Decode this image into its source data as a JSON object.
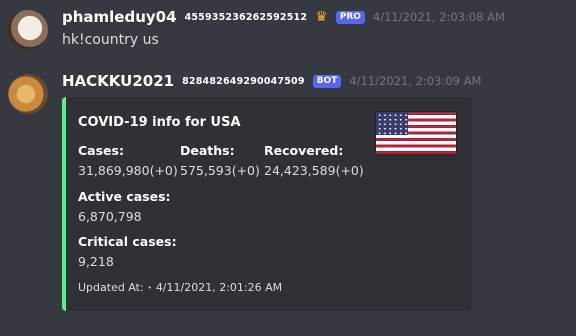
{
  "messages": [
    {
      "username": "phamleduy04",
      "user_id": "455935236262592512",
      "crown_icon": "crown-icon",
      "badge": "PRO",
      "timestamp": "4/11/2021, 2:03:08 AM",
      "text": "hk!country us"
    },
    {
      "username": "HACKKU2021",
      "user_id": "828482649290047509",
      "badge": "BOT",
      "timestamp": "4/11/2021, 2:03:09 AM"
    }
  ],
  "embed": {
    "accent_color": "#57f287",
    "title": "COVID-19 info for USA",
    "thumbnail": "us-flag",
    "fields": {
      "cases": {
        "name": "Cases:",
        "value": "31,869,980(+0)"
      },
      "deaths": {
        "name": "Deaths:",
        "value": "575,593(+0)"
      },
      "recovered": {
        "name": "Recovered:",
        "value": "24,423,589(+0)"
      },
      "active": {
        "name": "Active cases:",
        "value": "6,870,798"
      },
      "critical": {
        "name": "Critical cases:",
        "value": "9,218"
      }
    },
    "footer": {
      "label": "Updated At:",
      "separator": "•",
      "timestamp": "4/11/2021, 2:01:26 AM"
    }
  }
}
